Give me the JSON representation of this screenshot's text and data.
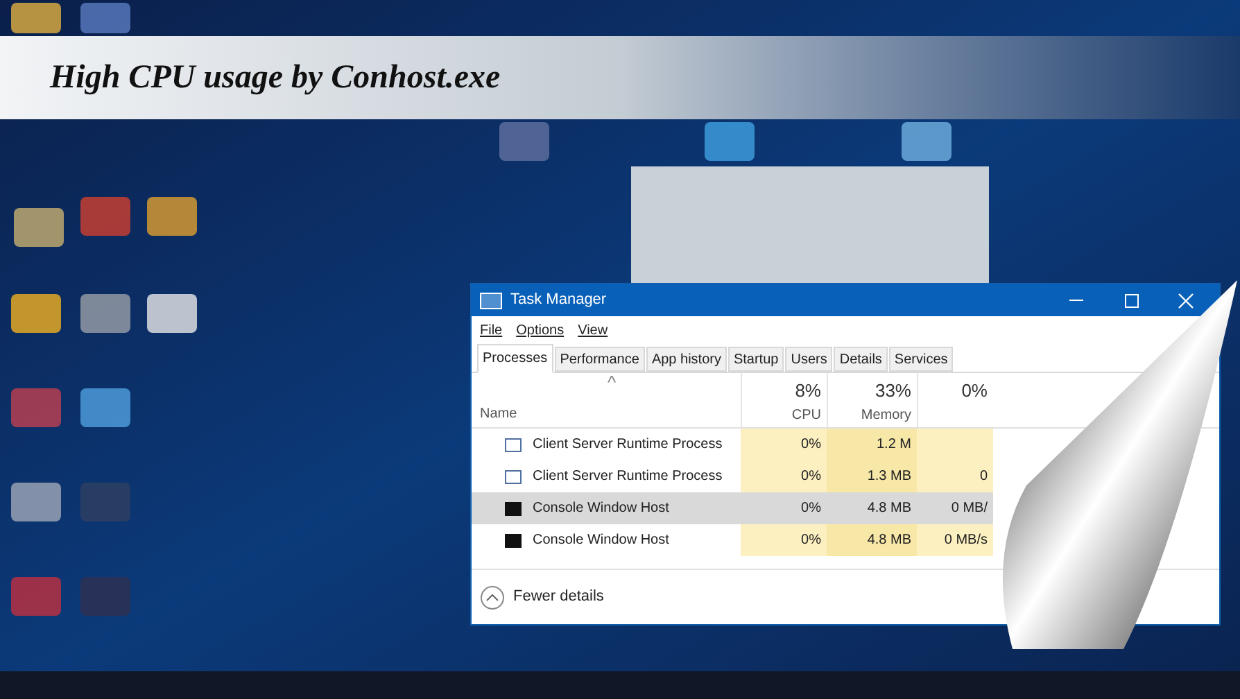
{
  "banner": {
    "title": "High CPU usage by Conhost.exe"
  },
  "window": {
    "title": "Task Manager"
  },
  "menu": [
    "File",
    "Options",
    "View"
  ],
  "tabs": [
    {
      "label": "Processes",
      "selected": true
    },
    {
      "label": "Performance",
      "selected": false
    },
    {
      "label": "App history",
      "selected": false
    },
    {
      "label": "Startup",
      "selected": false
    },
    {
      "label": "Users",
      "selected": false
    },
    {
      "label": "Details",
      "selected": false
    },
    {
      "label": "Services",
      "selected": false
    }
  ],
  "table": {
    "sort_indicator": "^",
    "columns": [
      {
        "label": "Name"
      },
      {
        "percent": "8%",
        "label": "CPU"
      },
      {
        "percent": "33%",
        "label": "Memory"
      },
      {
        "percent": "0%"
      }
    ],
    "rows": [
      {
        "kind": "service",
        "name": "Client Server Runtime Process",
        "cpu": "0%",
        "memory": "1.2 M",
        "column_3": "",
        "selected": false
      },
      {
        "kind": "service",
        "name": "Client Server Runtime Process",
        "cpu": "0%",
        "memory": "1.3 MB",
        "column_3": "0",
        "selected": false
      },
      {
        "kind": "console",
        "name": "Console Window Host",
        "cpu": "0%",
        "memory": "4.8 MB",
        "column_3": "0 MB/",
        "selected": true
      },
      {
        "kind": "console",
        "name": "Console Window Host",
        "cpu": "0%",
        "memory": "4.8 MB",
        "column_3": "0 MB/s",
        "selected": false
      }
    ]
  },
  "footer": {
    "label": "Fewer details"
  }
}
